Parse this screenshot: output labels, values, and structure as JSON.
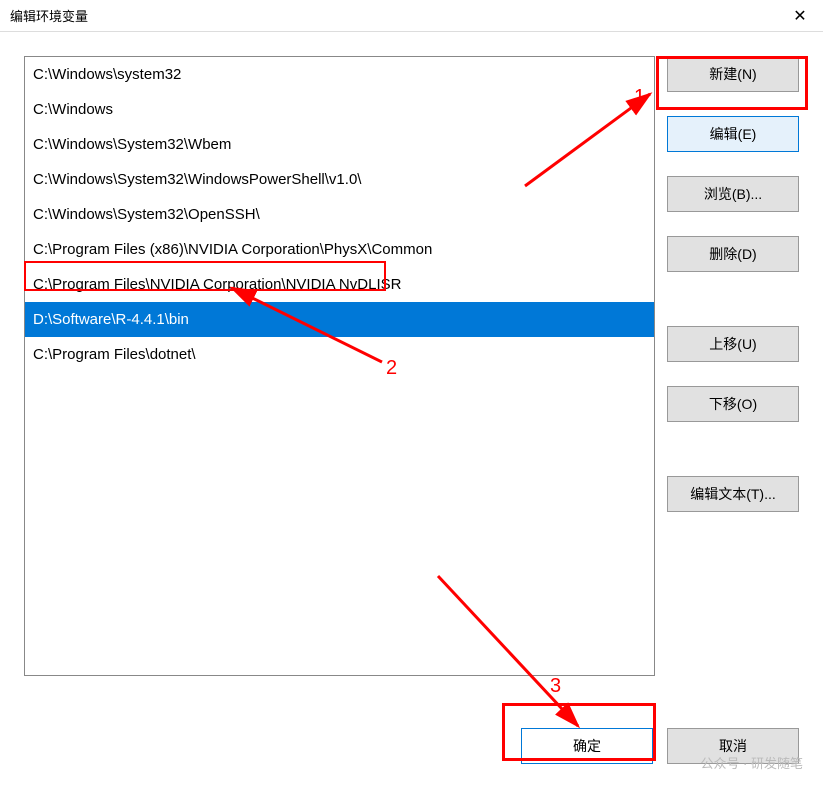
{
  "window": {
    "title": "编辑环境变量"
  },
  "list": {
    "items": [
      {
        "text": "C:\\Windows\\system32",
        "selected": false
      },
      {
        "text": "C:\\Windows",
        "selected": false
      },
      {
        "text": "C:\\Windows\\System32\\Wbem",
        "selected": false
      },
      {
        "text": "C:\\Windows\\System32\\WindowsPowerShell\\v1.0\\",
        "selected": false
      },
      {
        "text": "C:\\Windows\\System32\\OpenSSH\\",
        "selected": false
      },
      {
        "text": "C:\\Program Files (x86)\\NVIDIA Corporation\\PhysX\\Common",
        "selected": false
      },
      {
        "text": "C:\\Program Files\\NVIDIA Corporation\\NVIDIA NvDLISR",
        "selected": false
      },
      {
        "text": "D:\\Software\\R-4.4.1\\bin",
        "selected": true
      },
      {
        "text": "C:\\Program Files\\dotnet\\",
        "selected": false
      }
    ]
  },
  "buttons": {
    "new": "新建(N)",
    "edit": "编辑(E)",
    "browse": "浏览(B)...",
    "delete": "删除(D)",
    "moveup": "上移(U)",
    "movedown": "下移(O)",
    "edittext": "编辑文本(T)...",
    "ok": "确定",
    "cancel": "取消"
  },
  "annotations": {
    "n1": "1",
    "n2": "2",
    "n3": "3"
  },
  "watermark": "公众号 · 研发随笔"
}
